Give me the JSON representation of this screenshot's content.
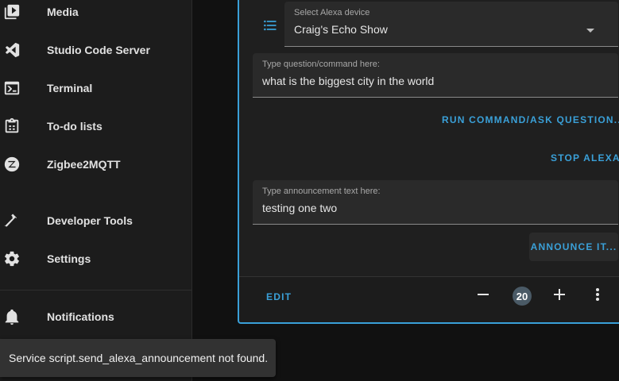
{
  "sidebar": {
    "items": [
      {
        "label": "Media",
        "icon": "play-box-icon"
      },
      {
        "label": "Studio Code Server",
        "icon": "vscode-icon"
      },
      {
        "label": "Terminal",
        "icon": "terminal-icon"
      },
      {
        "label": "To-do lists",
        "icon": "clipboard-list-icon"
      },
      {
        "label": "Zigbee2MQTT",
        "icon": "zigbee-icon"
      },
      {
        "label": "Developer Tools",
        "icon": "hammer-icon"
      },
      {
        "label": "Settings",
        "icon": "gear-icon"
      },
      {
        "label": "Notifications",
        "icon": "bell-icon"
      }
    ]
  },
  "card": {
    "device_select": {
      "label": "Select Alexa device",
      "value": "Craig's Echo Show"
    },
    "question_field": {
      "label": "Type question/command here:",
      "value": "what is the biggest city in the world"
    },
    "run_command_label": "RUN COMMAND/ASK QUESTION...",
    "stop_label": "STOP ALEXA",
    "announcement_field": {
      "label": "Type announcement text here:",
      "value": "testing one two"
    },
    "announce_label": "ANNOUNCE IT...",
    "footer": {
      "edit_label": "EDIT",
      "count": "20"
    }
  },
  "toast": {
    "message": "Service script.send_alexa_announcement not found."
  },
  "colors": {
    "accent": "#3aa0d8",
    "sidebar_bg": "#1c1c1c",
    "page_bg": "#111111",
    "card_bg": "#1f1f1f",
    "toast_bg": "#323232"
  }
}
